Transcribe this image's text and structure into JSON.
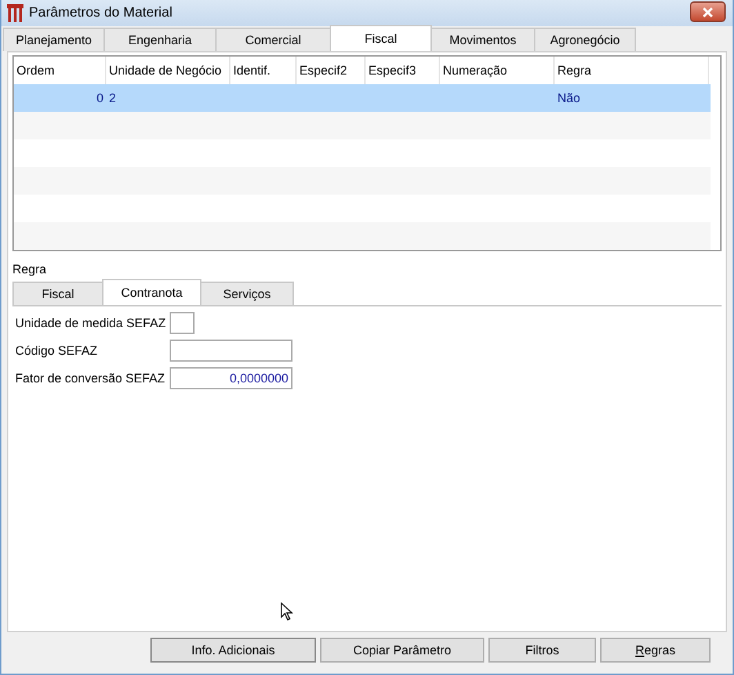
{
  "window": {
    "title": "Parâmetros do Material"
  },
  "tabs": [
    {
      "label": "Planejamento",
      "selected": false
    },
    {
      "label": "Engenharia",
      "selected": false
    },
    {
      "label": "Comercial",
      "selected": false
    },
    {
      "label": "Fiscal",
      "selected": true
    },
    {
      "label": "Movimentos",
      "selected": false
    },
    {
      "label": "Agronegócio",
      "selected": false
    }
  ],
  "table": {
    "columns": [
      "Ordem",
      "Unidade de Negócio",
      "Identif.",
      "Especif2",
      "Especif3",
      "Numeração",
      "Regra"
    ],
    "rows": [
      {
        "selected": true,
        "cells": [
          "0",
          "2",
          "",
          "",
          "",
          "",
          "Não"
        ]
      }
    ]
  },
  "section_label": "Regra",
  "subtabs": [
    {
      "label": "Fiscal",
      "selected": false
    },
    {
      "label": "Contranota",
      "selected": true
    },
    {
      "label": "Serviços",
      "selected": false
    }
  ],
  "fields": [
    {
      "label": "Unidade de medida SEFAZ",
      "kind": "small"
    },
    {
      "label": "Código SEFAZ",
      "kind": "wide"
    },
    {
      "label": "Fator de conversão SEFAZ",
      "kind": "wide",
      "value": "0,0000000"
    }
  ],
  "buttons": [
    {
      "label": "Info. Adicionais",
      "mnemonic": false
    },
    {
      "label": "Copiar Parâmetro",
      "mnemonic": false
    },
    {
      "label": "Filtros",
      "mnemonic": false
    },
    {
      "label": "Regras",
      "mnemonic": true
    }
  ]
}
